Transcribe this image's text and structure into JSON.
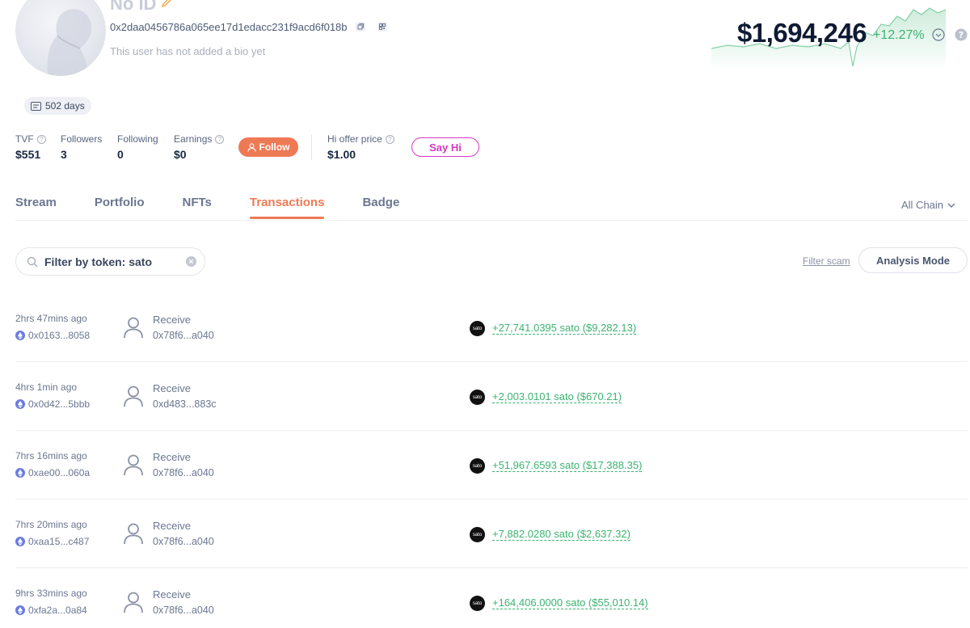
{
  "profile": {
    "name": "No ID",
    "address": "0x2daa0456786a065ee17d1edacc231f9acd6f018b",
    "bio": "This user has not added a bio yet",
    "days_badge": "502 days"
  },
  "stats": {
    "tvf": {
      "label": "TVF",
      "value": "$551"
    },
    "followers": {
      "label": "Followers",
      "value": "3"
    },
    "following": {
      "label": "Following",
      "value": "0"
    },
    "earnings": {
      "label": "Earnings",
      "value": "$0"
    },
    "hi_offer": {
      "label": "Hi offer price",
      "value": "$1.00"
    }
  },
  "buttons": {
    "follow": "Follow",
    "say_hi": "Say Hi",
    "analysis_mode": "Analysis Mode",
    "filter_scam": "Filter scam"
  },
  "net_worth": {
    "value": "$1,694,246",
    "change": "+12.27%"
  },
  "tabs": [
    {
      "label": "Stream",
      "active": false
    },
    {
      "label": "Portfolio",
      "active": false
    },
    {
      "label": "NFTs",
      "active": false
    },
    {
      "label": "Transactions",
      "active": true
    },
    {
      "label": "Badge",
      "active": false
    }
  ],
  "chain_filter": "All Chain",
  "search": {
    "value": "Filter by token: sato"
  },
  "colors": {
    "accent": "#ee7a55",
    "positive": "#3cb371",
    "say_hi": "#d538c2"
  },
  "transactions": [
    {
      "time": "2hrs 47mins ago",
      "hash": "0x0163...8058",
      "type": "Receive",
      "from": "0x78f6...a040",
      "token": "sato",
      "amount": "+27,741.0395 sato ($9,282.13)"
    },
    {
      "time": "4hrs 1min ago",
      "hash": "0x0d42...5bbb",
      "type": "Receive",
      "from": "0xd483...883c",
      "token": "sato",
      "amount": "+2,003.0101 sato ($670.21)"
    },
    {
      "time": "7hrs 16mins ago",
      "hash": "0xae00...060a",
      "type": "Receive",
      "from": "0x78f6...a040",
      "token": "sato",
      "amount": "+51,967.6593 sato ($17,388.35)"
    },
    {
      "time": "7hrs 20mins ago",
      "hash": "0xaa15...c487",
      "type": "Receive",
      "from": "0x78f6...a040",
      "token": "sato",
      "amount": "+7,882.0280 sato ($2,637.32)"
    },
    {
      "time": "9hrs 33mins ago",
      "hash": "0xfa2a...0a84",
      "type": "Receive",
      "from": "0x78f6...a040",
      "token": "sato",
      "amount": "+164,406.0000 sato ($55,010.14)"
    }
  ]
}
